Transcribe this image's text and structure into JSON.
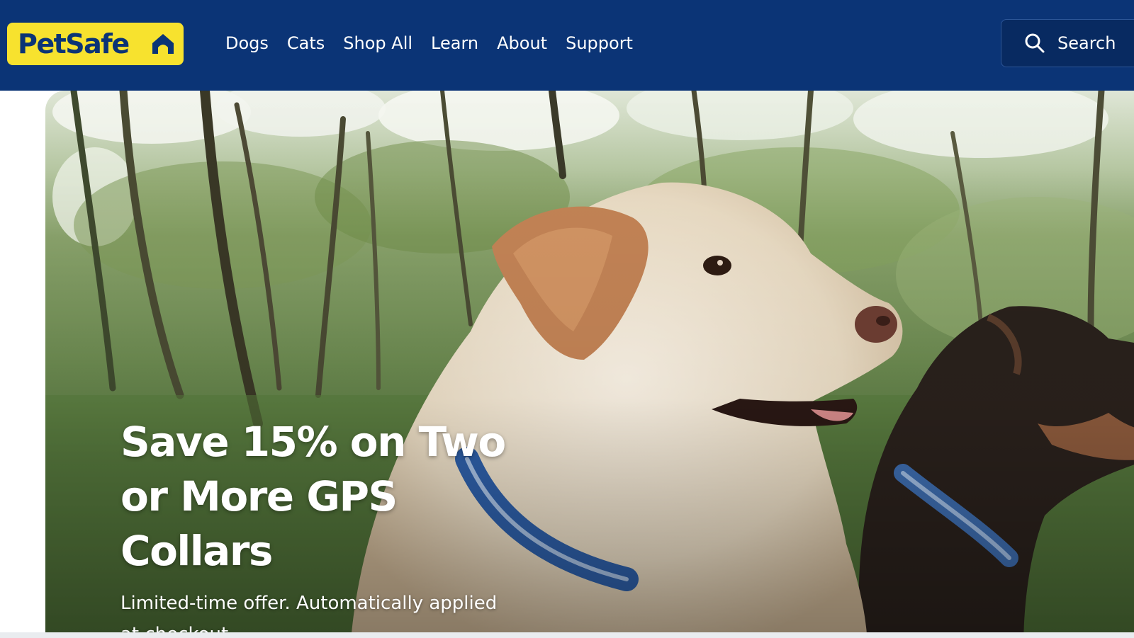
{
  "brand": {
    "name": "PetSafe",
    "colors": {
      "navy": "#0b3476",
      "yellow": "#f7e22e"
    }
  },
  "nav": {
    "items": [
      {
        "label": "Dogs"
      },
      {
        "label": "Cats"
      },
      {
        "label": "Shop All"
      },
      {
        "label": "Learn"
      },
      {
        "label": "About"
      },
      {
        "label": "Support"
      }
    ]
  },
  "search": {
    "label": "Search",
    "icon": "search-icon"
  },
  "hero": {
    "headline": "Save 15% on Two or More GPS Collars",
    "subtext": "Limited-time offer. Automatically applied at checkout."
  }
}
